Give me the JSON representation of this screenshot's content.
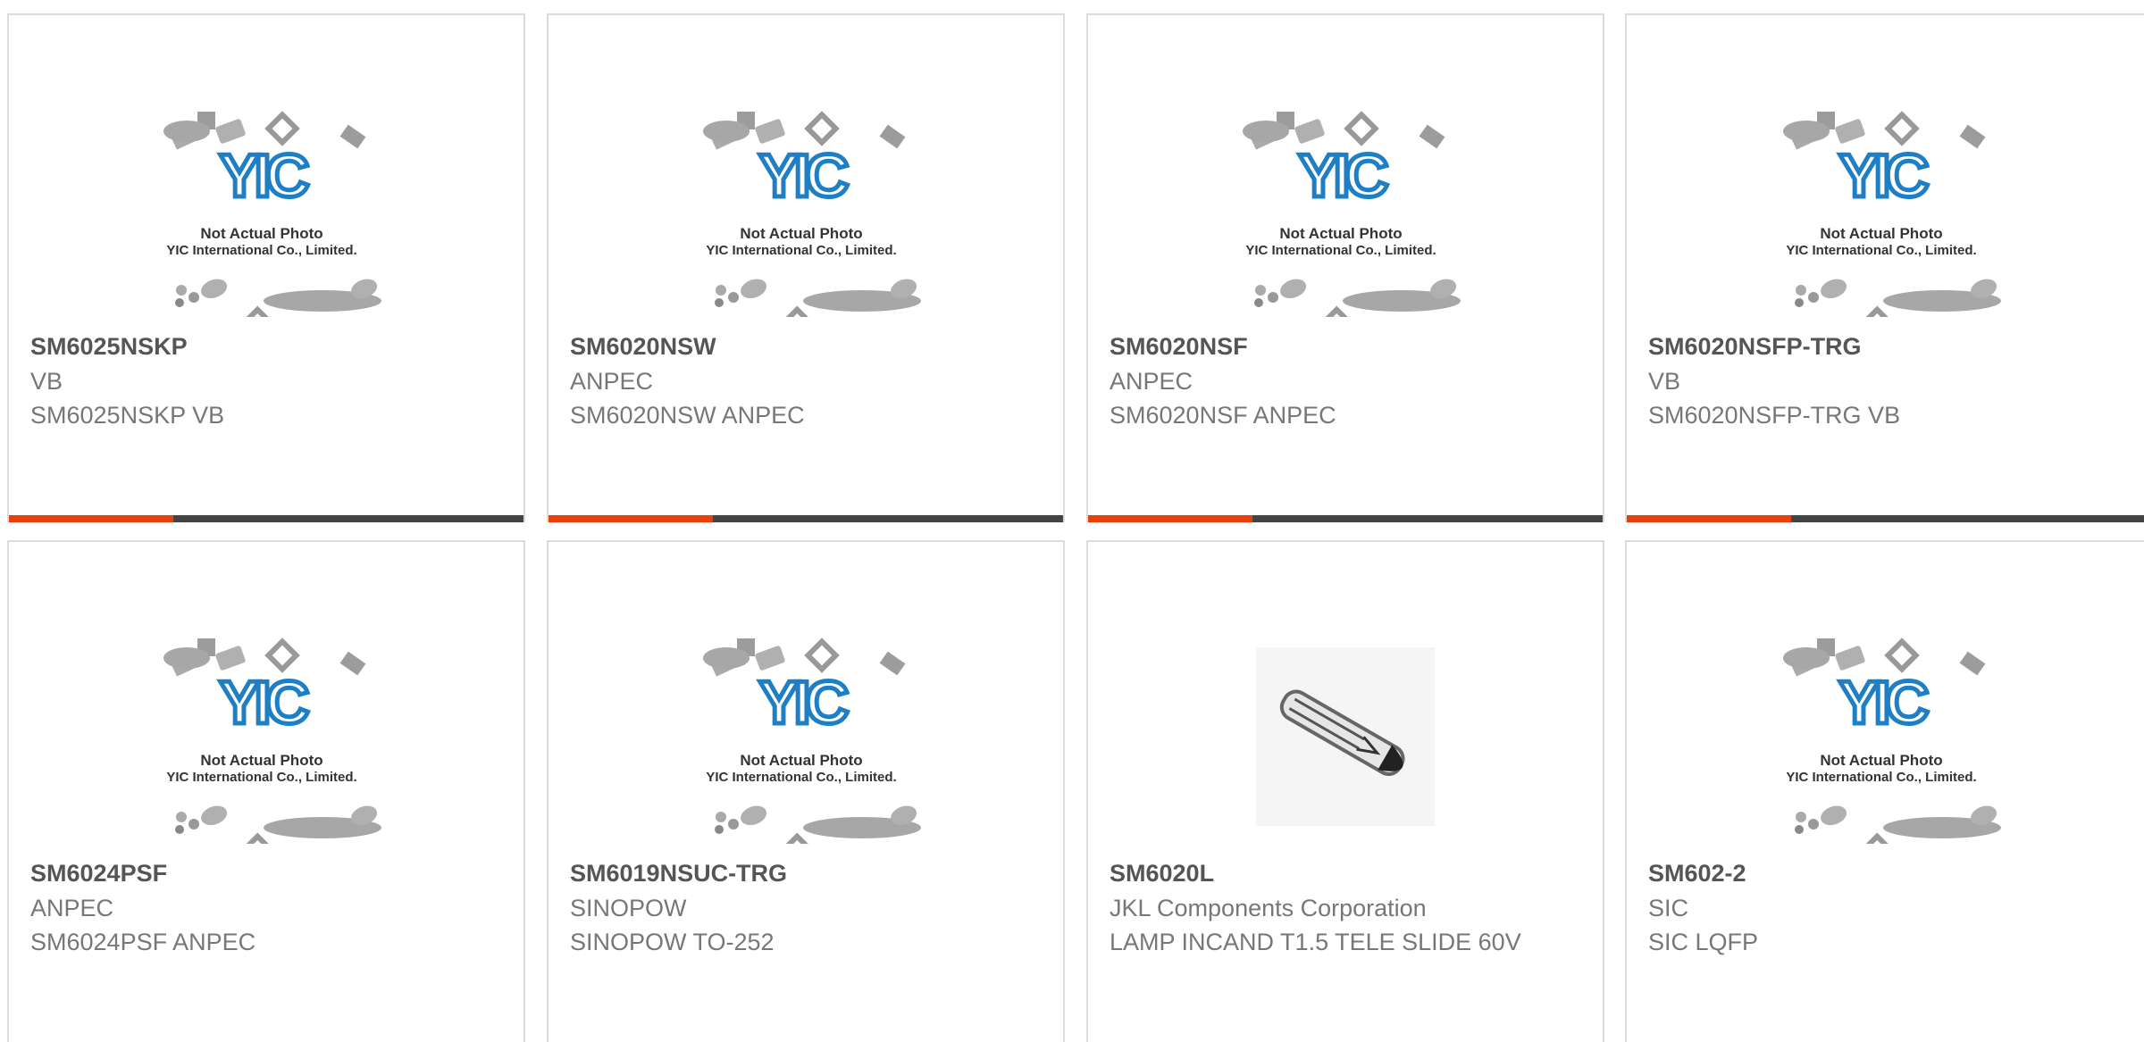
{
  "accent_color": "#e8400c",
  "bar_color": "#444444",
  "placeholder": {
    "logo_text": "YIC",
    "line1": "Not Actual Photo",
    "line2": "YIC International Co., Limited."
  },
  "products": [
    {
      "part": "SM6025NSKP",
      "manufacturer": "VB",
      "description": "SM6025NSKP VB",
      "image": "placeholder"
    },
    {
      "part": "SM6020NSW",
      "manufacturer": "ANPEC",
      "description": "SM6020NSW ANPEC",
      "image": "placeholder"
    },
    {
      "part": "SM6020NSF",
      "manufacturer": "ANPEC",
      "description": "SM6020NSF ANPEC",
      "image": "placeholder"
    },
    {
      "part": "SM6020NSFP-TRG",
      "manufacturer": "VB",
      "description": "SM6020NSFP-TRG VB",
      "image": "placeholder"
    },
    {
      "part": "SM6024PSF",
      "manufacturer": "ANPEC",
      "description": "SM6024PSF ANPEC",
      "image": "placeholder"
    },
    {
      "part": "SM6019NSUC-TRG",
      "manufacturer": "SINOPOW",
      "description": "SINOPOW TO-252",
      "image": "placeholder"
    },
    {
      "part": "SM6020L",
      "manufacturer": "JKL Components Corporation",
      "description": "LAMP INCAND T1.5 TELE SLIDE 60V",
      "image": "lamp-photo"
    },
    {
      "part": "SM602-2",
      "manufacturer": "SIC",
      "description": "SIC LQFP",
      "image": "placeholder"
    }
  ]
}
